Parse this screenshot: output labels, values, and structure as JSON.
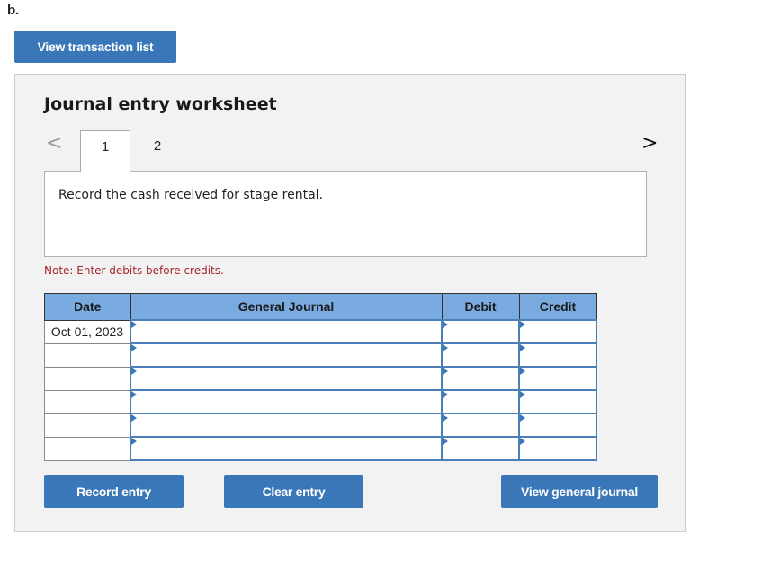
{
  "part_label": "b.",
  "view_transaction_list": "View transaction list",
  "worksheet": {
    "title": "Journal entry worksheet",
    "nav_prev_icon": "<",
    "nav_next_icon": ">",
    "tabs": [
      {
        "label": "1",
        "active": true
      },
      {
        "label": "2",
        "active": false
      }
    ],
    "description": "Record the cash received for stage rental.",
    "note": "Note: Enter debits before credits.",
    "table": {
      "headers": {
        "date": "Date",
        "general_journal": "General Journal",
        "debit": "Debit",
        "credit": "Credit"
      },
      "rows": [
        {
          "date": "Oct 01, 2023",
          "account": "",
          "debit": "",
          "credit": ""
        },
        {
          "date": "",
          "account": "",
          "debit": "",
          "credit": ""
        },
        {
          "date": "",
          "account": "",
          "debit": "",
          "credit": ""
        },
        {
          "date": "",
          "account": "",
          "debit": "",
          "credit": ""
        },
        {
          "date": "",
          "account": "",
          "debit": "",
          "credit": ""
        },
        {
          "date": "",
          "account": "",
          "debit": "",
          "credit": ""
        }
      ]
    },
    "buttons": {
      "record": "Record entry",
      "clear": "Clear entry",
      "view_journal": "View general journal"
    }
  }
}
